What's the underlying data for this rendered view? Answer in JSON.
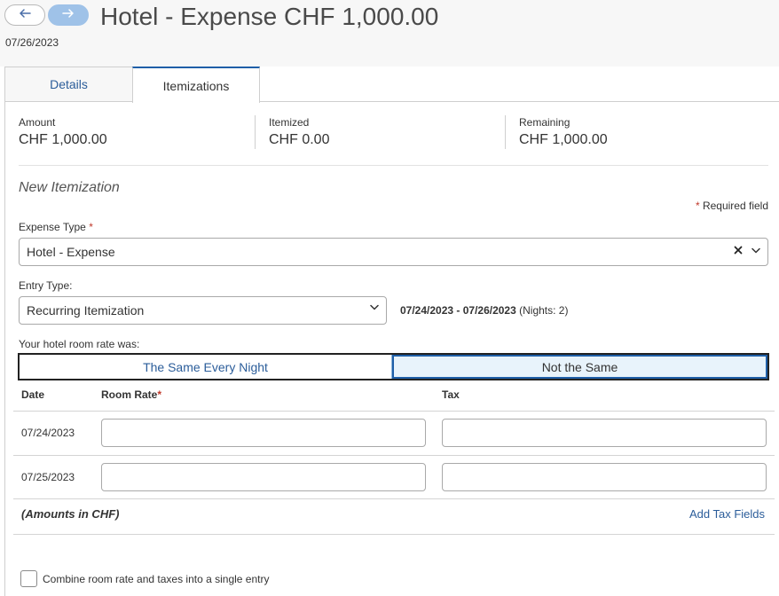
{
  "header": {
    "back_icon": "arrow-left-icon",
    "forward_icon": "arrow-right-icon",
    "title": "Hotel - Expense CHF 1,000.00",
    "date": "07/26/2023"
  },
  "tabs": [
    {
      "label": "Details",
      "active": false
    },
    {
      "label": "Itemizations",
      "active": true
    }
  ],
  "summary": {
    "amount_label": "Amount",
    "amount_value": "CHF 1,000.00",
    "itemized_label": "Itemized",
    "itemized_value": "CHF 0.00",
    "remaining_label": "Remaining",
    "remaining_value": "CHF 1,000.00"
  },
  "form": {
    "section_title": "New Itemization",
    "required_marker": "*",
    "required_note": "Required field",
    "expense_type_label": "Expense Type",
    "expense_type_value": "Hotel - Expense",
    "entry_type_label": "Entry Type:",
    "entry_type_value": "Recurring Itemization",
    "date_range": "07/24/2023 - 07/26/2023",
    "nights": "(Nights: 2)",
    "room_rate_question": "Your hotel room rate was:",
    "rate_options": [
      "The Same Every Night",
      "Not the Same"
    ],
    "rate_selected": "Not the Same"
  },
  "table": {
    "headers": {
      "date": "Date",
      "room_rate": "Room Rate",
      "tax": "Tax"
    },
    "rows": [
      {
        "date": "07/24/2023",
        "room_rate": "",
        "tax": ""
      },
      {
        "date": "07/25/2023",
        "room_rate": "",
        "tax": ""
      }
    ],
    "amounts_note": "(Amounts in CHF)",
    "add_tax_link": "Add Tax Fields"
  },
  "combine": {
    "label": "Combine room rate and taxes into a single entry",
    "checked": false
  },
  "colors": {
    "accent": "#1f5fa8",
    "link": "#2b5d9a",
    "required": "#c0392b",
    "selected_bg": "#e8f3fb"
  }
}
